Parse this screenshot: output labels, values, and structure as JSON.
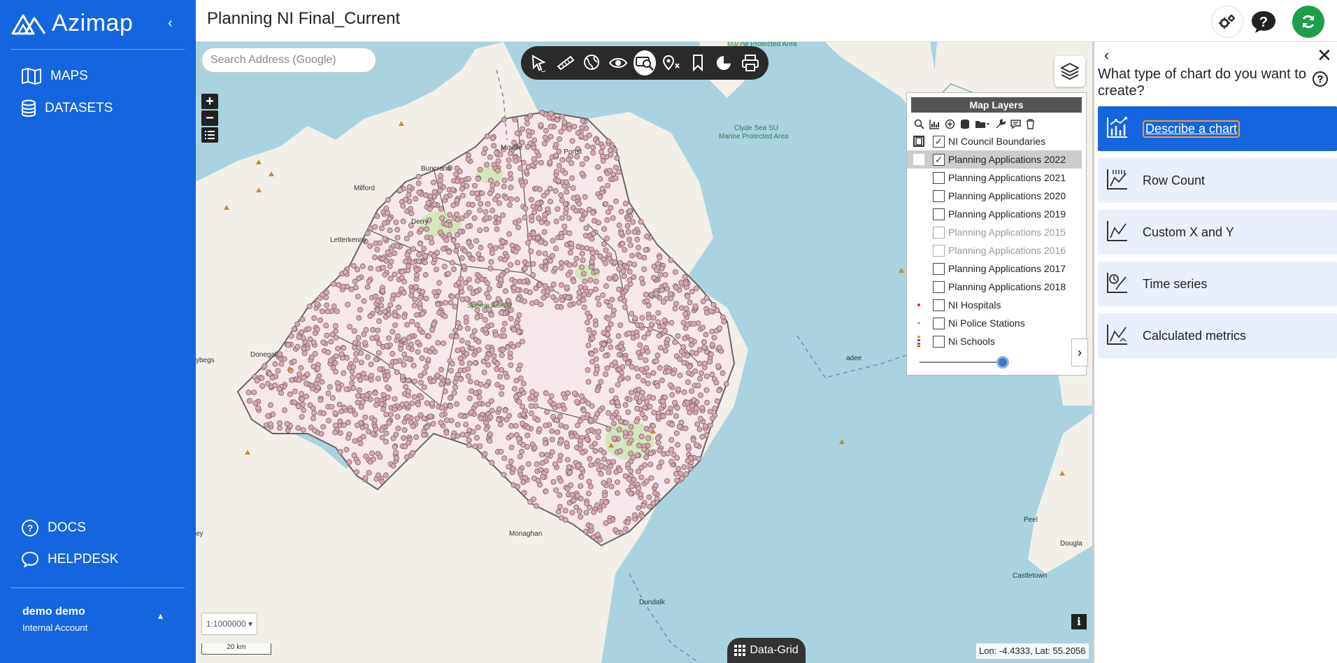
{
  "sidebar": {
    "logo": "Azimap",
    "nav": [
      {
        "label": "MAPS",
        "icon": "map-book-icon"
      },
      {
        "label": "DATASETS",
        "icon": "database-icon"
      }
    ],
    "bottom_nav": [
      {
        "label": "DOCS",
        "icon": "question-circle-icon"
      },
      {
        "label": "HELPDESK",
        "icon": "chat-bubble-icon"
      }
    ],
    "user": {
      "name": "demo demo",
      "account": "Internal Account"
    }
  },
  "header": {
    "title": "Planning NI Final_Current",
    "buttons": [
      "settings-icon",
      "help-icon",
      "refresh-icon"
    ],
    "refresh_color": "#1f9e4a"
  },
  "map": {
    "search_placeholder": "Search Address (Google)",
    "zoom_in": "+",
    "zoom_out": "−",
    "scale_select": "1:1000000",
    "scale_bar": "20 km",
    "data_grid": "Data-Grid",
    "info": "i",
    "coordinates": "Lon: -4.4333, Lat: 55.2056",
    "labels": {
      "marine1": "Marine Protected Area",
      "clyde": "Clyde Sea SU",
      "marine2": "Marine Protected Area",
      "moville": "Moville",
      "buncrana": "Buncrana",
      "milford": "Milford",
      "derry": "Derry",
      "letterkenny": "Letterkenny",
      "donegal": "Donegal",
      "sperrin": "Sperrin AONB",
      "portstewart": "Portst",
      "monaghan": "Monaghan",
      "dundalk": "Dundalk",
      "peel": "Peel",
      "douglas": "Dougla",
      "castletown": "Castletown",
      "adee": "adee",
      "ybegs": "ybegs",
      "ey": "ey"
    }
  },
  "layers": {
    "title": "Map Layers",
    "items": [
      {
        "name": "NI Council Boundaries",
        "checked": true,
        "disabled": false,
        "highlight": false
      },
      {
        "name": "Planning Applications 2022",
        "checked": true,
        "disabled": false,
        "highlight": true
      },
      {
        "name": "Planning Applications 2021",
        "checked": false,
        "disabled": false,
        "highlight": false
      },
      {
        "name": "Planning Applications 2020",
        "checked": false,
        "disabled": false,
        "highlight": false
      },
      {
        "name": "Planning Applications 2019",
        "checked": false,
        "disabled": false,
        "highlight": false
      },
      {
        "name": "Planning Applications 2015",
        "checked": false,
        "disabled": true,
        "highlight": false
      },
      {
        "name": "Planning Applications 2016",
        "checked": false,
        "disabled": true,
        "highlight": false
      },
      {
        "name": "Planning Applications 2017",
        "checked": false,
        "disabled": false,
        "highlight": false
      },
      {
        "name": "Planning Applications 2018",
        "checked": false,
        "disabled": false,
        "highlight": false
      },
      {
        "name": "NI Hospitals",
        "checked": false,
        "disabled": false,
        "highlight": false
      },
      {
        "name": "Ni Police Stations",
        "checked": false,
        "disabled": false,
        "highlight": false
      },
      {
        "name": "Ni Schools",
        "checked": false,
        "disabled": false,
        "highlight": false
      }
    ],
    "opacity": 0.85
  },
  "chart_panel": {
    "question": "What type of chart do you want to create?",
    "options": [
      {
        "label": "Describe a chart",
        "selected": true
      },
      {
        "label": "Row Count",
        "selected": false
      },
      {
        "label": "Custom X and Y",
        "selected": false
      },
      {
        "label": "Time series",
        "selected": false
      },
      {
        "label": "Calculated metrics",
        "selected": false
      }
    ]
  },
  "colors": {
    "sidebar": "#1565e0",
    "water": "#aad3df",
    "land": "#f2efe9",
    "points": "#d8a8b0"
  }
}
